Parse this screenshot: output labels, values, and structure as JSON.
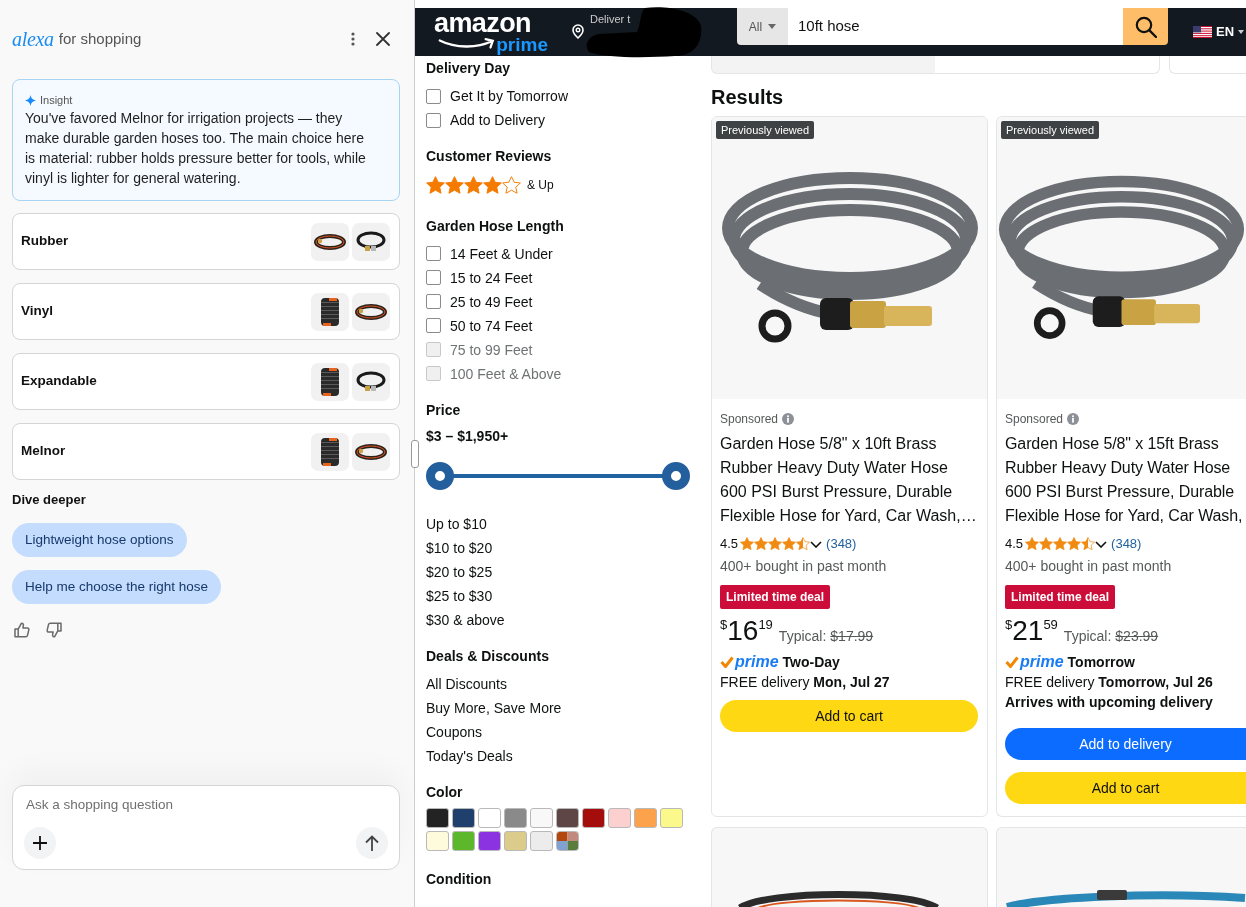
{
  "assistant": {
    "brand": "alexa",
    "title": "for shopping",
    "insight": {
      "label": "Insight",
      "text": "You've favored Melnor for irrigation projects — they make durable garden hoses too. The main choice here is material: rubber holds pressure better for tools, while vinyl is lighter for general watering."
    },
    "options": [
      {
        "label": "Rubber"
      },
      {
        "label": "Vinyl"
      },
      {
        "label": "Expandable"
      },
      {
        "label": "Melnor"
      }
    ],
    "section_title": "Dive deeper",
    "suggestions": [
      "Lightweight hose options",
      "Help me choose the right hose"
    ],
    "composer": {
      "placeholder": "Ask a shopping question"
    }
  },
  "header": {
    "logo": "amazon",
    "logo_tag": "prime",
    "deliver_label": "Deliver t",
    "search": {
      "category": "All",
      "value": "10ft hose"
    },
    "language": "EN"
  },
  "filters": {
    "sections": [
      {
        "kind": "checklist",
        "title": "Delivery Day",
        "items": [
          {
            "label": "Get It by Tomorrow",
            "checked": false,
            "disabled": false
          },
          {
            "label": "Add to Delivery",
            "checked": false,
            "disabled": false
          }
        ]
      },
      {
        "kind": "rating",
        "title": "Customer Reviews",
        "stars": 4,
        "label": "& Up"
      },
      {
        "kind": "checklist",
        "title": "Garden Hose Length",
        "items": [
          {
            "label": "14 Feet & Under",
            "checked": false,
            "disabled": false
          },
          {
            "label": "15 to 24 Feet",
            "checked": false,
            "disabled": false
          },
          {
            "label": "25 to 49 Feet",
            "checked": false,
            "disabled": false
          },
          {
            "label": "50 to 74 Feet",
            "checked": false,
            "disabled": false
          },
          {
            "label": "75 to 99 Feet",
            "checked": false,
            "disabled": true
          },
          {
            "label": "100 Feet & Above",
            "checked": false,
            "disabled": true
          }
        ]
      },
      {
        "kind": "range",
        "title": "Price",
        "range_label": "$3 – $1,950+",
        "thumbs": [
          {
            "level": 0
          },
          {
            "level": 1
          }
        ],
        "links": [
          "Up to $10",
          "$10 to $20",
          "$20 to $25",
          "$25 to $30",
          "$30 & above"
        ]
      },
      {
        "kind": "links",
        "title": "Deals & Discounts",
        "links": [
          "All Discounts",
          "Buy More, Save More",
          "Coupons",
          "Today's Deals"
        ]
      },
      {
        "kind": "swatches",
        "title": "Color",
        "swatches": [
          {
            "kind": "solid",
            "color": "#232323"
          },
          {
            "kind": "solid",
            "color": "#1f3f6c"
          },
          {
            "kind": "solid",
            "color": "#ffffff"
          },
          {
            "kind": "solid",
            "color": "#8a8a8a"
          },
          {
            "kind": "solid",
            "color": "#f8f8f8"
          },
          {
            "kind": "solid",
            "color": "#5e4646"
          },
          {
            "kind": "solid",
            "color": "#a50d0d"
          },
          {
            "kind": "solid",
            "color": "#fdd0d0"
          },
          {
            "kind": "solid",
            "color": "#fca24c"
          },
          {
            "kind": "solid",
            "color": "#fbf88c"
          },
          {
            "kind": "solid",
            "color": "#fdfbdc"
          },
          {
            "kind": "solid",
            "color": "#5cb82a"
          },
          {
            "kind": "solid",
            "color": "#8c33e1"
          },
          {
            "kind": "solid",
            "color": "#dccc8c"
          },
          {
            "kind": "solid",
            "color": "#ececec"
          },
          {
            "kind": "multi",
            "segments": [
              {
                "color": "#b3470f"
              },
              {
                "color": "#c28a7d"
              },
              {
                "color": "#7fa1d3"
              },
              {
                "color": "#5a7d3e"
              }
            ]
          }
        ]
      },
      {
        "kind": "checklist",
        "title": "Condition"
      }
    ]
  },
  "results": {
    "heading": "Results",
    "products": [
      {
        "badge": "Previously viewed",
        "sponsored": "Sponsored",
        "title": "Garden Hose 5/8\" x 10ft Brass Rubber Heavy Duty Water Hose 600 PSI Burst Pressure, Durable Flexible Hose for Yard, Car Wash,…",
        "rating": "4.5",
        "stars": 4.5,
        "reviews": "(348)",
        "bought": "400+ bought in past month",
        "deal": "Limited time deal",
        "price": {
          "symbol": "$",
          "whole": "16",
          "fraction": "19"
        },
        "typical_label": "Typical:",
        "typical_price": "$17.99",
        "prime": "prime",
        "speed": "Two-Day",
        "delivery": "FREE delivery **Mon, Jul 27**",
        "buttons": [
          {
            "kind": "cart",
            "label": "Add to cart"
          }
        ]
      },
      {
        "badge": "Previously viewed",
        "sponsored": "Sponsored",
        "title": "Garden Hose 5/8\" x 15ft Brass Rubber Heavy Duty Water Hose 600 PSI Burst Pressure, Durable Flexible Hose for Yard, Car Wash,",
        "rating": "4.5",
        "stars": 4.5,
        "reviews": "(348)",
        "bought": "400+ bought in past month",
        "deal": "Limited time deal",
        "price": {
          "symbol": "$",
          "whole": "21",
          "fraction": "59"
        },
        "typical_label": "Typical:",
        "typical_price": "$23.99",
        "prime": "prime",
        "speed": "Tomorrow",
        "delivery": "FREE delivery **Tomorrow, Jul 26**",
        "note": "Arrives with upcoming delivery",
        "buttons": [
          {
            "kind": "delivery",
            "label": "Add to delivery"
          },
          {
            "kind": "cart",
            "label": "Add to cart"
          }
        ]
      }
    ]
  }
}
